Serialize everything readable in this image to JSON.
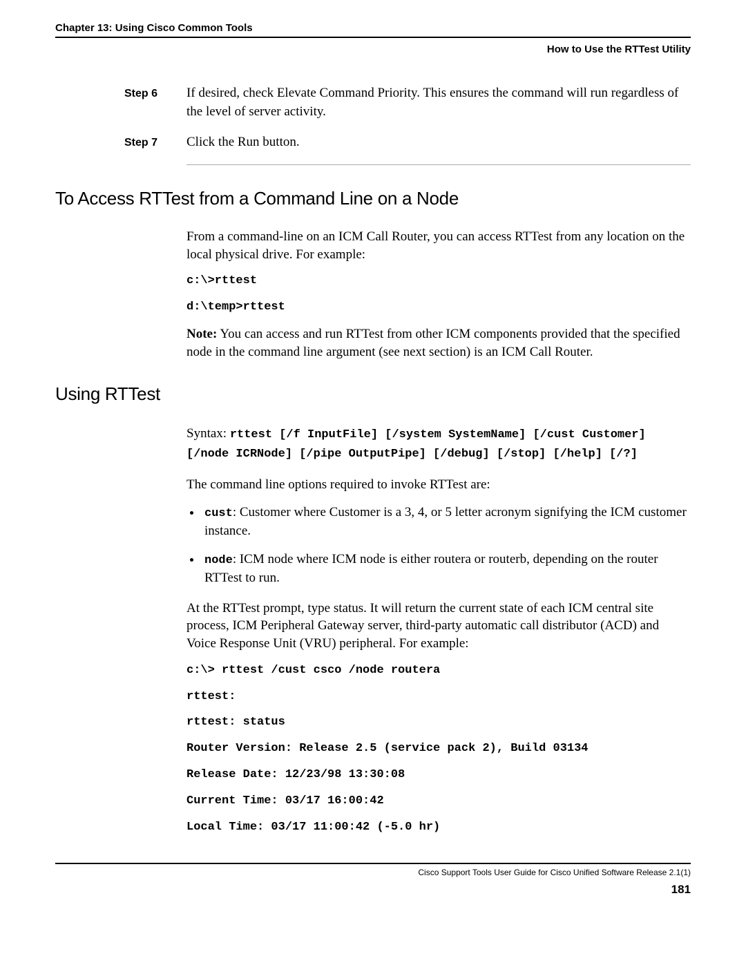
{
  "header": {
    "chapter": "Chapter 13: Using Cisco Common Tools",
    "subtitle": "How to Use the RTTest Utility"
  },
  "steps": [
    {
      "label": "Step 6",
      "text": "If desired, check Elevate Command Priority. This ensures the command will run regardless of the level of server activity."
    },
    {
      "label": "Step 7",
      "text": "Click the Run button."
    }
  ],
  "section1": {
    "heading": "To Access RTTest from a Command Line on a Node",
    "intro": "From a command-line on an ICM Call Router, you can access RTTest from any location on the local physical drive. For example:",
    "code1": "c:\\>rttest",
    "code2": "d:\\temp>rttest",
    "note_label": "Note:",
    "note_text": " You can access and run RTTest from other ICM components provided that the specified node in the command line argument (see next section) is an ICM Call Router."
  },
  "section2": {
    "heading": "Using RTTest",
    "syntax_label": "Syntax: ",
    "syntax_code": "rttest [/f InputFile] [/system SystemName] [/cust Customer] [/node ICRNode] [/pipe OutputPipe] [/debug] [/stop] [/help] [/?]",
    "opts_intro": "The command line options required to invoke RTTest are:",
    "opts": [
      {
        "key": "cust",
        "text": ": Customer where Customer is a 3, 4, or 5 letter acronym signifying the ICM customer instance."
      },
      {
        "key": "node",
        "text": ": ICM node where ICM node is either routera or routerb, depending on the router RTTest to run."
      }
    ],
    "prompt_text": "At the RTTest prompt, type status. It will return the current state of each ICM central site process, ICM Peripheral Gateway server, third-party automatic call distributor (ACD) and Voice Response Unit (VRU) peripheral. For example:",
    "codelines": [
      "c:\\> rttest /cust csco /node routera",
      "rttest:",
      "rttest: status",
      "Router Version: Release 2.5 (service pack 2), Build 03134",
      "Release Date: 12/23/98 13:30:08",
      "Current Time: 03/17 16:00:42",
      "Local Time: 03/17 11:00:42 (-5.0 hr)"
    ]
  },
  "footer": {
    "doc_title": "Cisco Support Tools User Guide for Cisco Unified Software Release 2.1(1)",
    "page": "181"
  }
}
